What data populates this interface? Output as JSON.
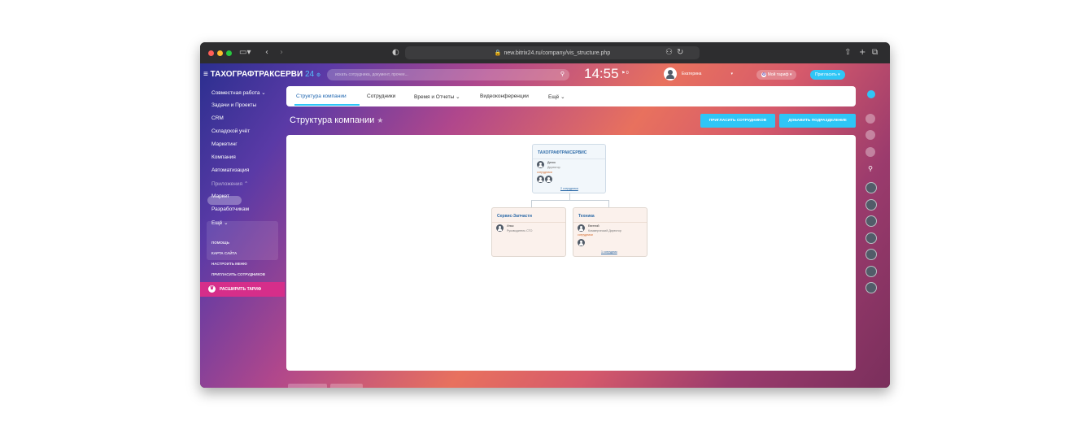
{
  "browser": {
    "url": "new.bitrix24.ru/company/vis_structure.php"
  },
  "header": {
    "company_name": "ТАХОГРАФТРАКСЕРВИ",
    "brand_suffix": "24",
    "search_placeholder": "искать сотрудника, документ, прочее...",
    "time": "14:55",
    "flag_count": "0",
    "user_name": "Екатерина",
    "tariff_label": "Мой тариф",
    "invite_label": "Пригласить"
  },
  "sidebar": {
    "items": [
      {
        "label": "Совместная работа"
      },
      {
        "label": "Задачи и Проекты"
      },
      {
        "label": "CRM"
      },
      {
        "label": "Складской учёт"
      },
      {
        "label": "Маркетинг"
      },
      {
        "label": "Компания"
      },
      {
        "label": "Автоматизация"
      },
      {
        "label": "Приложения"
      },
      {
        "label": "Маркет"
      },
      {
        "label": "Разработчикам"
      },
      {
        "label": "Ещё"
      }
    ],
    "footer_links": [
      "ПОМОЩЬ",
      "КАРТА САЙТА",
      "НАСТРОИТЬ МЕНЮ",
      "ПРИГЛАСИТЬ СОТРУДНИКОВ"
    ],
    "expand_tariff": "РАСШИРИТЬ ТАРИФ"
  },
  "tabs": [
    {
      "label": "Структура компании"
    },
    {
      "label": "Сотрудники"
    },
    {
      "label": "Время и Отчеты"
    },
    {
      "label": "Видеоконференции"
    },
    {
      "label": "Ещё"
    }
  ],
  "page": {
    "title": "Структура компании",
    "invite_button": "ПРИГЛАСИТЬ СОТРУДНИКОВ",
    "add_department_button": "ДОБАВИТЬ ПОДРАЗДЕЛЕНИЕ"
  },
  "structure": {
    "root": {
      "name": "ТАХОГРАФТРАКСЕРВИС",
      "head_name": "Денис",
      "head_role": "Директор",
      "employees_label": "сотрудники",
      "count_link": "2 сотрудника"
    },
    "children": [
      {
        "name": "Сервис-Запчасти",
        "head_name": "Илья",
        "head_role": "Руководитель СТО"
      },
      {
        "name": "Техника",
        "head_name": "Евгений",
        "head_role": "Коммерческий Директор",
        "employees_label": "сотрудники",
        "count_link": "1 сотрудник"
      }
    ]
  },
  "colors": {
    "accent": "#2fc6f6",
    "expand_tariff": "#d62e8a",
    "link": "#2e6ba8"
  }
}
